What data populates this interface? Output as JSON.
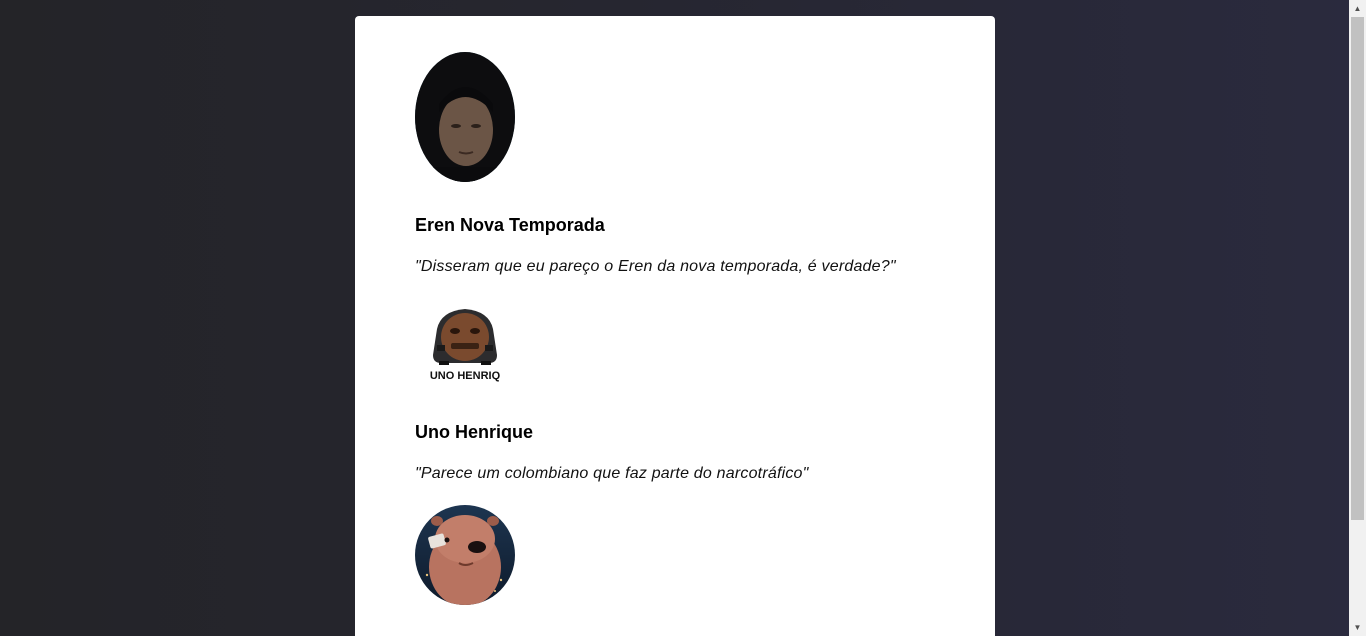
{
  "entries": [
    {
      "avatar_icon": "portrait-hooded-person",
      "name": "Eren Nova Temporada",
      "quote": "\"Disseram que eu pareço o Eren da nova temporada, é verdade?\""
    },
    {
      "avatar_icon": "car-face-meme",
      "avatar_caption": "UNO HENRIQ",
      "name": "Uno Henrique",
      "quote": "\"Parece um colombiano que faz parte do narcotráfico\""
    },
    {
      "avatar_icon": "capybara-cartoon"
    }
  ],
  "colors": {
    "background_dark": "#262630",
    "card": "#ffffff",
    "text": "#000000"
  }
}
